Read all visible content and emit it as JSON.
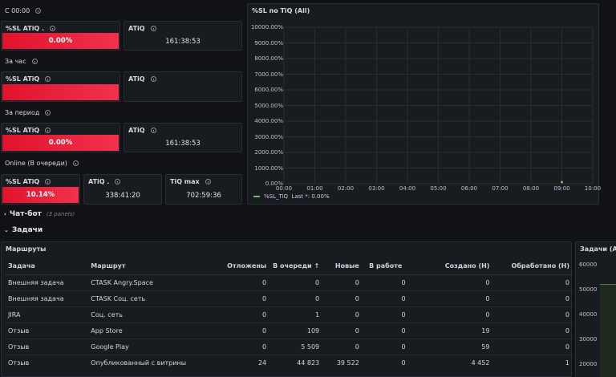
{
  "sections": {
    "since_midnight": "С 00:00",
    "hour": "За час",
    "period": "За период",
    "online": "Online (В очереди)"
  },
  "stats": {
    "p1": {
      "title": "%SL ATiQ .",
      "value": "0.00%"
    },
    "p2": {
      "title": "ATiQ",
      "value": "161:38:53"
    },
    "p3": {
      "title": "%SL ATiQ",
      "value": ""
    },
    "p4": {
      "title": "ATiQ",
      "value": ""
    },
    "p5": {
      "title": "%SL ATiQ",
      "value": "0.00%"
    },
    "p6": {
      "title": "ATiQ",
      "value": "161:38:53"
    },
    "p7": {
      "title": "%SL ATiQ",
      "value": "10.14%",
      "fill_fraction": 0.9855
    },
    "p8": {
      "title": "ATiQ .",
      "value": "338:41:20"
    },
    "p9": {
      "title": "TiQ max",
      "value": "702:59:36"
    }
  },
  "rows": {
    "chatbot": {
      "label": "Чат-бот",
      "hint": "(3 panels)"
    },
    "tasks": {
      "label": "Задачи"
    }
  },
  "chart_panel": {
    "title": "%SL по TiQ (All)",
    "legend": "%SL_TiQ",
    "legend_stat": "Last *: 0.00%"
  },
  "chart_data": {
    "type": "line",
    "title": "%SL по TiQ (All)",
    "y_ticks": [
      "10000.00%",
      "9000.00%",
      "8000.00%",
      "7000.00%",
      "6000.00%",
      "5000.00%",
      "4000.00%",
      "3000.00%",
      "2000.00%",
      "1000.00%",
      "0.00%"
    ],
    "x_ticks": [
      "00:00",
      "01:00",
      "02:00",
      "03:00",
      "04:00",
      "05:00",
      "06:00",
      "07:00",
      "08:00",
      "09:00",
      "10:00"
    ],
    "ylim": [
      0,
      10000
    ],
    "xlim_hours": [
      0,
      10
    ],
    "grid": true,
    "legend_position": "bottom-left",
    "series": [
      {
        "name": "%SL_TiQ",
        "color": "#73bf69",
        "points": [
          {
            "x_hours": 9.0,
            "y": 0.0
          }
        ]
      }
    ]
  },
  "routes_panel": {
    "title": "Маршруты",
    "columns": [
      "Задача",
      "Маршрут",
      "Отложены",
      "В очереди",
      "Новые",
      "В работе",
      "Создано (H)",
      "Обработано (H)"
    ],
    "sort_indicator": "↑",
    "rows": [
      [
        "Внешняя задача",
        "CTASK Angry.Space",
        "0",
        "0",
        "0",
        "0",
        "0",
        "0"
      ],
      [
        "Внешняя задача",
        "CTASK Соц. сеть",
        "0",
        "0",
        "0",
        "0",
        "0",
        "0"
      ],
      [
        "JIRA",
        "Соц. сеть",
        "0",
        "1",
        "0",
        "0",
        "0",
        "0"
      ],
      [
        "Отзыв",
        "App Store",
        "0",
        "109",
        "0",
        "0",
        "19",
        "0"
      ],
      [
        "Отзыв",
        "Google Play",
        "0",
        "5 509",
        "0",
        "0",
        "59",
        "0"
      ],
      [
        "Отзыв",
        "Опубликованный с витрины",
        "24",
        "44 823",
        "39 522",
        "0",
        "4 452",
        "1"
      ]
    ]
  },
  "tasks_panel": {
    "title": "Задачи (All)",
    "y_ticks": [
      "60000",
      "50000",
      "40000",
      "30000",
      "20000"
    ]
  },
  "colors": {
    "background": "#111217",
    "panel": "#181b1f",
    "red": "#e0132c",
    "series_green": "#73bf69"
  }
}
